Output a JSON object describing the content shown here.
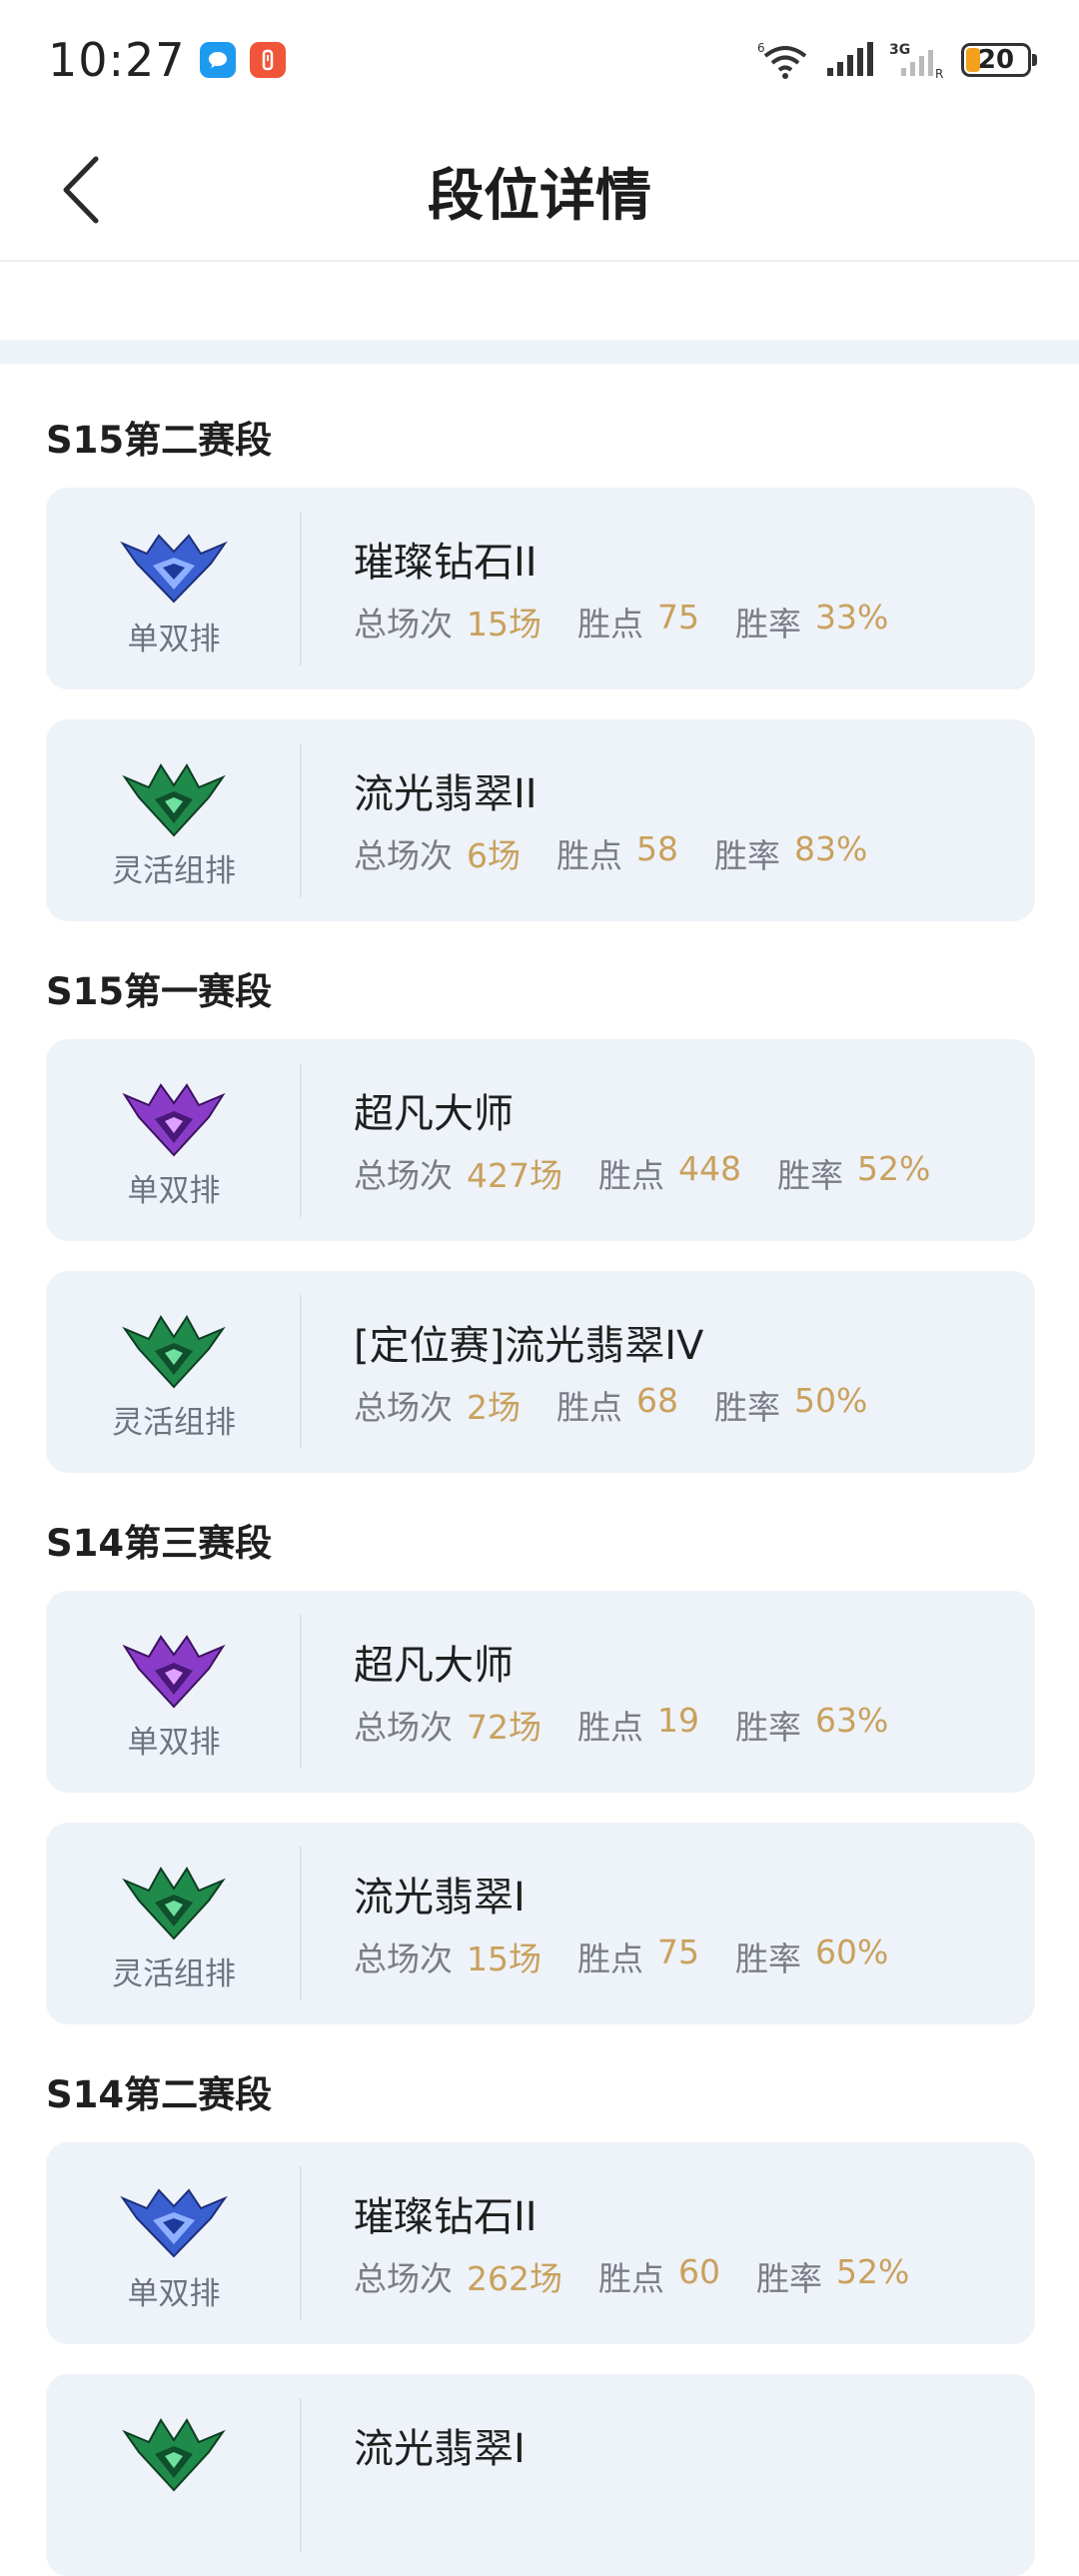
{
  "status_bar": {
    "time": "10:27",
    "battery": "20",
    "colors": {
      "chat_icon": "#1e9bf0",
      "alert_icon": "#f0553a",
      "battery_fill": "#f3a01d"
    }
  },
  "header": {
    "title": "段位详情",
    "back_icon": "chevron-left-icon"
  },
  "stat_labels": {
    "games": "总场次",
    "points": "胜点",
    "winrate": "胜率"
  },
  "colors": {
    "accent_value": "#c9a15d",
    "card_bg": "#eef2f9",
    "diamond": "#3a5fd0",
    "emerald": "#1f8a4a",
    "master": "#8a3cc8"
  },
  "seasons": [
    {
      "title": "S15第二赛段",
      "cards": [
        {
          "queue": "单双排",
          "rank": "璀璨钻石II",
          "games": "15场",
          "points": "75",
          "winrate": "33%",
          "badge": "diamond-emblem-icon"
        },
        {
          "queue": "灵活组排",
          "rank": "流光翡翠II",
          "games": "6场",
          "points": "58",
          "winrate": "83%",
          "badge": "emerald-emblem-icon"
        }
      ]
    },
    {
      "title": "S15第一赛段",
      "cards": [
        {
          "queue": "单双排",
          "rank": "超凡大师",
          "games": "427场",
          "points": "448",
          "winrate": "52%",
          "badge": "master-emblem-icon"
        },
        {
          "queue": "灵活组排",
          "rank": "[定位赛]流光翡翠IV",
          "games": "2场",
          "points": "68",
          "winrate": "50%",
          "badge": "emerald-emblem-icon"
        }
      ]
    },
    {
      "title": "S14第三赛段",
      "cards": [
        {
          "queue": "单双排",
          "rank": "超凡大师",
          "games": "72场",
          "points": "19",
          "winrate": "63%",
          "badge": "master-emblem-icon"
        },
        {
          "queue": "灵活组排",
          "rank": "流光翡翠I",
          "games": "15场",
          "points": "75",
          "winrate": "60%",
          "badge": "emerald-emblem-icon"
        }
      ]
    },
    {
      "title": "S14第二赛段",
      "cards": [
        {
          "queue": "单双排",
          "rank": "璀璨钻石II",
          "games": "262场",
          "points": "60",
          "winrate": "52%",
          "badge": "diamond-emblem-icon"
        },
        {
          "queue": "",
          "rank": "流光翡翠I",
          "games": "",
          "points": "",
          "winrate": "",
          "badge": "emerald-emblem-icon"
        }
      ]
    }
  ]
}
